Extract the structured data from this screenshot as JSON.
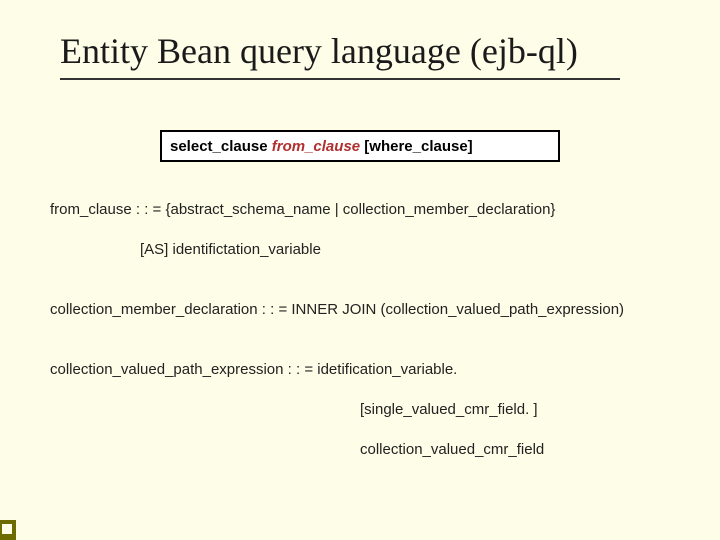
{
  "title": "Entity Bean query language (ejb-ql)",
  "syntax": {
    "select": "select_clause ",
    "from": "from_clause",
    "where": " [where_clause]"
  },
  "lines": {
    "l1": "from_clause : : = {abstract_schema_name  |   collection_member_declaration}",
    "l2": "[AS] identifictation_variable",
    "l3": "collection_member_declaration : : = INNER JOIN  (collection_valued_path_expression)",
    "l4": "collection_valued_path_expression : : = idetification_variable.",
    "l5": "[single_valued_cmr_field. ]",
    "l6": "collection_valued_cmr_field"
  }
}
